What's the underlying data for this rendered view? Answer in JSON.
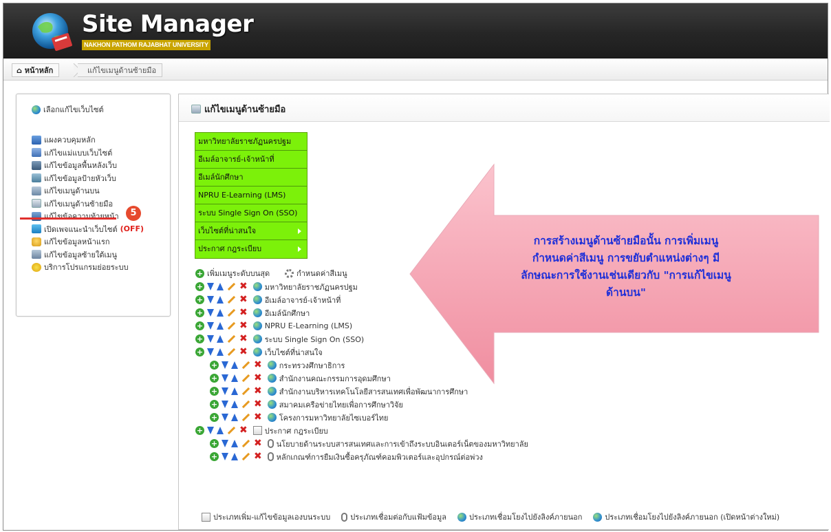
{
  "header": {
    "title": "Site Manager",
    "subtitle": "NAKHON PATHOM RAJABHAT UNIVERSITY"
  },
  "breadcrumb": {
    "home": "หน้าหลัก",
    "current": "แก้ไขเมนูด้านซ้ายมือ"
  },
  "sidebar": {
    "pick_site": "เลือกแก้ไขเว็บไซต์",
    "items": [
      {
        "label": "แผงควบคุมหลัก",
        "icon": "dashboard-icon"
      },
      {
        "label": "แก้ไขแม่แบบเว็บไซต์",
        "icon": "template-icon"
      },
      {
        "label": "แก้ไขข้อมูลพื้นหลังเว็บ",
        "icon": "background-icon"
      },
      {
        "label": "แก้ไขข้อมูลป้ายหัวเว็บ",
        "icon": "banner-icon"
      },
      {
        "label": "แก้ไขเมนูด้านบน",
        "icon": "top-menu-icon"
      },
      {
        "label": "แก้ไขเมนูด้านซ้ายมือ",
        "icon": "left-menu-icon"
      },
      {
        "label": "แก้ไขข้อความท้ายหน้า",
        "icon": "footer-icon"
      },
      {
        "label": "เปิดเพจแนะนำเว็บไซต์",
        "suffix": "(OFF)",
        "icon": "intro-page-icon"
      },
      {
        "label": "แก้ไขข้อมูลหน้าแรก",
        "icon": "home-icon"
      },
      {
        "label": "แก้ไขข้อมูลซ้ายใต้เมนู",
        "icon": "under-menu-icon"
      },
      {
        "label": "บริการโปรแกรมย่อยระบบ",
        "icon": "subprogram-icon"
      }
    ],
    "badge": "5"
  },
  "main": {
    "title": "แก้ไขเมนูด้านซ้ายมือ",
    "preview_menu": [
      {
        "label": "มหาวิทยาลัยราชภัฏนครปฐม",
        "has_sub": false
      },
      {
        "label": "อีเมล์อาจารย์-เจ้าหน้าที่",
        "has_sub": false
      },
      {
        "label": "อีเมล์นักศึกษา",
        "has_sub": false
      },
      {
        "label": "NPRU E-Learning (LMS)",
        "has_sub": false
      },
      {
        "label": "ระบบ Single Sign On (SSO)",
        "has_sub": false
      },
      {
        "label": "เว็บไซต์ที่น่าสนใจ",
        "has_sub": true
      },
      {
        "label": "ประกาศ กฎระเบียบ",
        "has_sub": true
      }
    ],
    "add_top_label": "เพิ่มเมนูระดับบนสุด",
    "set_color_label": "กำหนดค่าสีเมนู",
    "tree": [
      {
        "label": "มหาวิทยาลัยราชภัฏนครปฐม",
        "level": 0,
        "type": "link"
      },
      {
        "label": "อีเมล์อาจารย์-เจ้าหน้าที่",
        "level": 0,
        "type": "link"
      },
      {
        "label": "อีเมล์นักศึกษา",
        "level": 0,
        "type": "link"
      },
      {
        "label": "NPRU E-Learning (LMS)",
        "level": 0,
        "type": "link"
      },
      {
        "label": "ระบบ Single Sign On (SSO)",
        "level": 0,
        "type": "link"
      },
      {
        "label": "เว็บไซต์ที่น่าสนใจ",
        "level": 0,
        "type": "link"
      },
      {
        "label": "กระทรวงศึกษาธิการ",
        "level": 1,
        "type": "link"
      },
      {
        "label": "สำนักงานคณะกรรมการอุดมศึกษา",
        "level": 1,
        "type": "link"
      },
      {
        "label": "สำนักงานบริหารเทคโนโลยีสารสนเทศเพื่อพัฒนาการศึกษา",
        "level": 1,
        "type": "link"
      },
      {
        "label": "สมาคมเครือข่ายไทยเพื่อการศึกษาวิจัย",
        "level": 1,
        "type": "link"
      },
      {
        "label": "โครงการมหาวิทยาลัยไซเบอร์ไทย",
        "level": 1,
        "type": "link"
      },
      {
        "label": "ประกาศ กฎระเบียบ",
        "level": 0,
        "type": "page"
      },
      {
        "label": "นโยบายด้านระบบสารสนเทศและการเข้าถึงระบบอินเตอร์เน็ตของมหาวิทยาลัย",
        "level": 1,
        "type": "file"
      },
      {
        "label": "หลักเกณฑ์การยืมเงินซื้อครุภัณฑ์คอมพิวเตอร์และอุปกรณ์ต่อพ่วง",
        "level": 1,
        "type": "file"
      }
    ],
    "legend": [
      {
        "label": "ประเภทเพิ่ม-แก้ไขข้อมูลเองบนระบบ",
        "icon": "page-edit-icon"
      },
      {
        "label": "ประเภทเชื่อมต่อกับแฟ้มข้อมูล",
        "icon": "paperclip-icon"
      },
      {
        "label": "ประเภทเชื่อมโยงไปยังลิงค์ภายนอก",
        "icon": "globe-icon"
      },
      {
        "label": "ประเภทเชื่อมโยงไปยังลิงค์ภายนอก (เปิดหน้าต่างใหม่)",
        "icon": "globe-newwindow-icon"
      }
    ]
  },
  "callout": {
    "lines": [
      "การสร้างเมนูด้านซ้ายมือนั้น การเพิ่มเมนู",
      "กำหนดค่าสีเมนู การขยับตำแหน่งต่างๆ มี",
      "ลักษณะการใช้งานเช่นเดียวกับ \"การแก้ไขเมนู",
      "ด้านบน\""
    ]
  },
  "colors": {
    "menu_green": "#7cf10a",
    "callout_fill": "#f6a3b2",
    "callout_text": "#1e2fd8",
    "badge": "#e64a2e"
  }
}
